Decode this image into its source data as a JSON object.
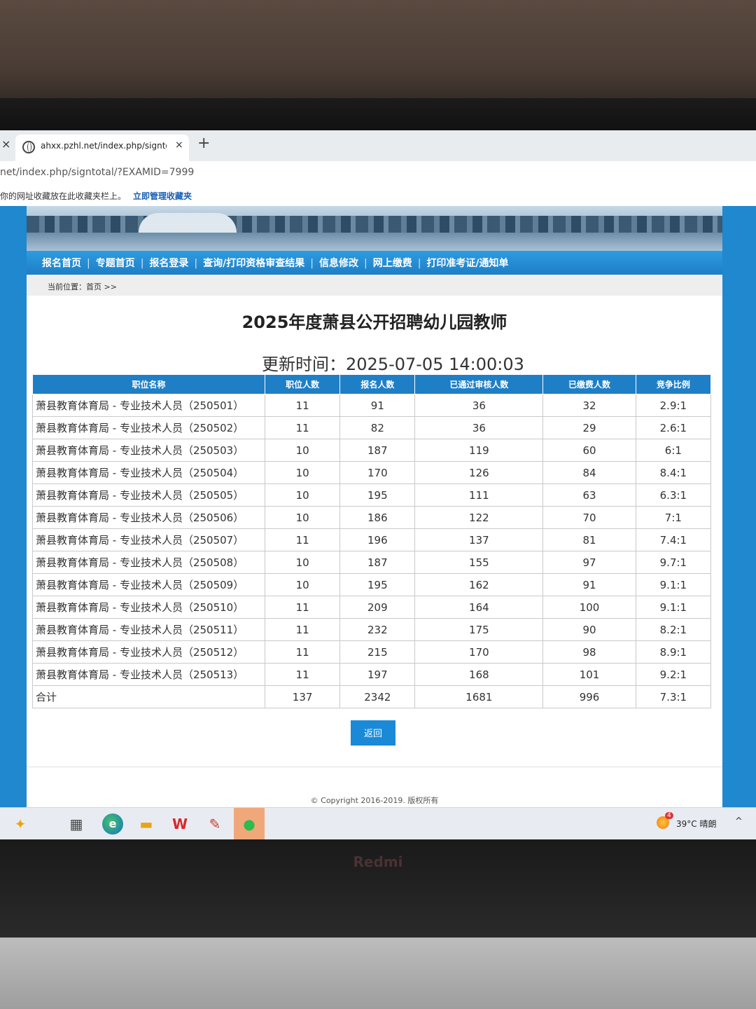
{
  "browser": {
    "tab_title": "ahxx.pzhl.net/index.php/signtotal",
    "tab_close": "×",
    "new_tab": "+",
    "left_close": "×",
    "url": "net/index.php/signtotal/?EXAMID=7999",
    "fav_hint": "你的网址收藏放在此收藏夹栏上。",
    "fav_manage": "立即管理收藏夹"
  },
  "nav": {
    "items": [
      "报名首页",
      "专题首页",
      "报名登录",
      "查询/打印资格审查结果",
      "信息修改",
      "网上缴费",
      "打印准考证/通知单"
    ],
    "separator": "|"
  },
  "breadcrumb": "当前位置：首页 >>",
  "page_title": "2025年度萧县公开招聘幼儿园教师",
  "update_time": "更新时间：2025-07-05 14:00:03",
  "table": {
    "headers": [
      "职位名称",
      "职位人数",
      "报名人数",
      "已通过审核人数",
      "已缴费人数",
      "竞争比例"
    ],
    "rows": [
      [
        "萧县教育体育局 - 专业技术人员（250501）",
        "11",
        "91",
        "36",
        "32",
        "2.9:1"
      ],
      [
        "萧县教育体育局 - 专业技术人员（250502）",
        "11",
        "82",
        "36",
        "29",
        "2.6:1"
      ],
      [
        "萧县教育体育局 - 专业技术人员（250503）",
        "10",
        "187",
        "119",
        "60",
        "6:1"
      ],
      [
        "萧县教育体育局 - 专业技术人员（250504）",
        "10",
        "170",
        "126",
        "84",
        "8.4:1"
      ],
      [
        "萧县教育体育局 - 专业技术人员（250505）",
        "10",
        "195",
        "111",
        "63",
        "6.3:1"
      ],
      [
        "萧县教育体育局 - 专业技术人员（250506）",
        "10",
        "186",
        "122",
        "70",
        "7:1"
      ],
      [
        "萧县教育体育局 - 专业技术人员（250507）",
        "11",
        "196",
        "137",
        "81",
        "7.4:1"
      ],
      [
        "萧县教育体育局 - 专业技术人员（250508）",
        "10",
        "187",
        "155",
        "97",
        "9.7:1"
      ],
      [
        "萧县教育体育局 - 专业技术人员（250509）",
        "10",
        "195",
        "162",
        "91",
        "9.1:1"
      ],
      [
        "萧县教育体育局 - 专业技术人员（250510）",
        "11",
        "209",
        "164",
        "100",
        "9.1:1"
      ],
      [
        "萧县教育体育局 - 专业技术人员（250511）",
        "11",
        "232",
        "175",
        "90",
        "8.2:1"
      ],
      [
        "萧县教育体育局 - 专业技术人员（250512）",
        "11",
        "215",
        "170",
        "98",
        "8.9:1"
      ],
      [
        "萧县教育体育局 - 专业技术人员（250513）",
        "11",
        "197",
        "168",
        "101",
        "9.2:1"
      ]
    ],
    "total": [
      "合计",
      "137",
      "2342",
      "1681",
      "996",
      "7.3:1"
    ]
  },
  "back_button": "返回",
  "copyright": "© Copyright 2016-2019. 版权所有",
  "taskbar": {
    "weather_badge": "4",
    "weather": "39°C  晴朗",
    "chevron": "^",
    "icons": [
      "copilot-icon",
      "widgets-icon",
      "edge-icon",
      "file-explorer-icon",
      "wps-icon",
      "app-icon",
      "wechat-icon"
    ]
  },
  "laptop": {
    "brand": "Redmi"
  },
  "colors": {
    "site_blue": "#1e7fc6",
    "nav_blue": "#2f9be0",
    "button_blue": "#1a8ad8"
  }
}
